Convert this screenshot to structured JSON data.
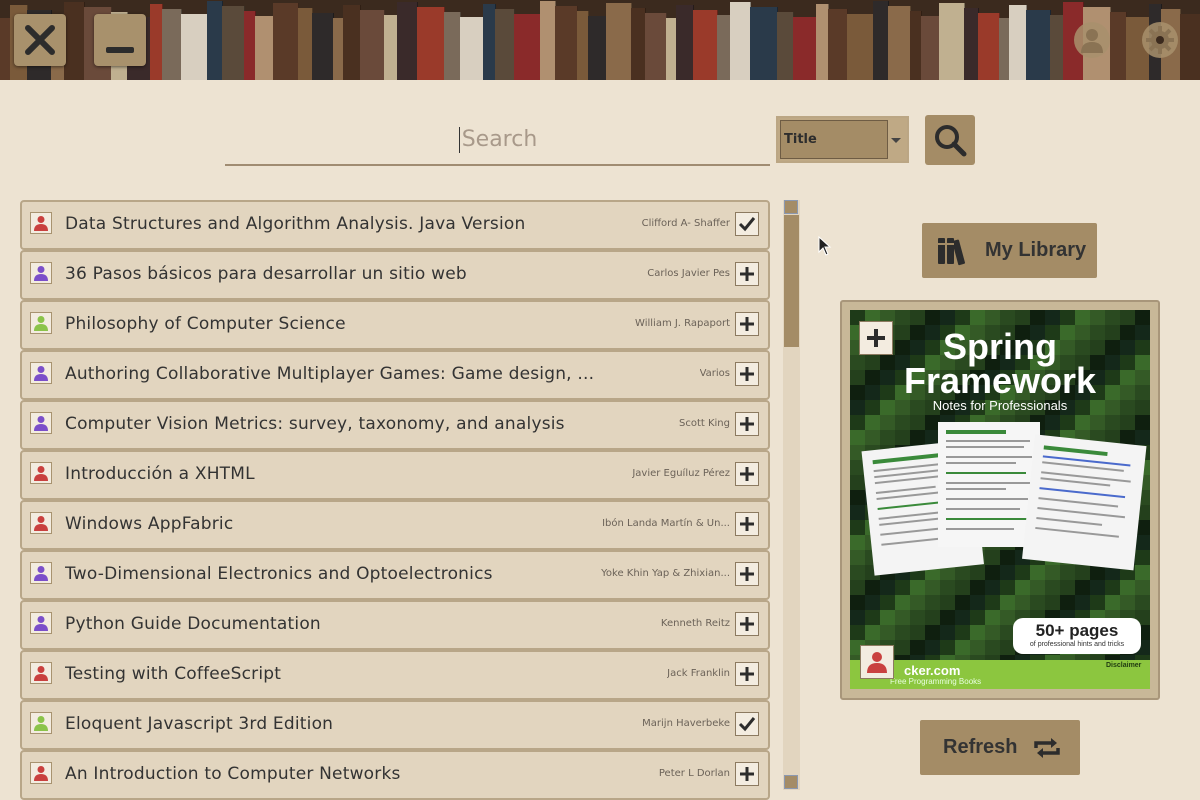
{
  "header": {
    "close_icon": "close-icon",
    "minimize_icon": "minimize-icon",
    "user_icon": "user-icon",
    "settings_icon": "gear-icon"
  },
  "search": {
    "placeholder": "Search",
    "value": "",
    "filter_selected": "Title",
    "button_icon": "search-icon"
  },
  "colors": {
    "accent": "#a48c66",
    "background": "#ede3d2",
    "row": "#e2d5bf",
    "status_red": "#c9413f",
    "status_purple": "#7b4fc9",
    "status_green": "#8bc34a"
  },
  "books": [
    {
      "title": "Data Structures and Algorithm Analysis. Java Version",
      "author": "Clifford A- Shaffer",
      "status": "red",
      "action": "check"
    },
    {
      "title": "36 Pasos básicos para desarrollar un sitio web",
      "author": "Carlos Javier Pes",
      "status": "purple",
      "action": "plus"
    },
    {
      "title": "Philosophy of Computer Science",
      "author": "William J. Rapaport",
      "status": "green",
      "action": "plus"
    },
    {
      "title": "Authoring Collaborative Multiplayer Games: Game design, ...",
      "author": "Varios",
      "status": "purple",
      "action": "plus"
    },
    {
      "title": "Computer Vision Metrics: survey, taxonomy, and analysis",
      "author": "Scott King",
      "status": "purple",
      "action": "plus"
    },
    {
      "title": "Introducción a XHTML",
      "author": "Javier Eguíluz Pérez",
      "status": "red",
      "action": "plus"
    },
    {
      "title": "Windows AppFabric",
      "author": "Ibón Landa Martín & Un...",
      "status": "red",
      "action": "plus"
    },
    {
      "title": "Two-Dimensional Electronics and Optoelectronics",
      "author": "Yoke Khin Yap & Zhixian...",
      "status": "purple",
      "action": "plus"
    },
    {
      "title": "Python Guide Documentation",
      "author": "Kenneth Reitz",
      "status": "purple",
      "action": "plus"
    },
    {
      "title": "Testing with CoffeeScript",
      "author": "Jack Franklin",
      "status": "red",
      "action": "plus"
    },
    {
      "title": "Eloquent Javascript 3rd Edition",
      "author": "Marijn Haverbeke",
      "status": "green",
      "action": "check"
    },
    {
      "title": "An Introduction to Computer Networks",
      "author": "Peter L Dorlan",
      "status": "red",
      "action": "plus"
    }
  ],
  "library": {
    "label": "My Library",
    "icon": "books-icon"
  },
  "cover": {
    "title_line1": "Spring",
    "title_line2": "Framework",
    "subtitle": "Notes for Professionals",
    "pages_badge": "50+ pages",
    "pages_sub": "of professional hints and tricks",
    "site": "cker.com",
    "site_sub": "Free Programming Books",
    "disclaimer": "Disclaimer",
    "add_icon": "plus-icon",
    "status": "red"
  },
  "refresh": {
    "label": "Refresh",
    "icon": "refresh-icon"
  }
}
